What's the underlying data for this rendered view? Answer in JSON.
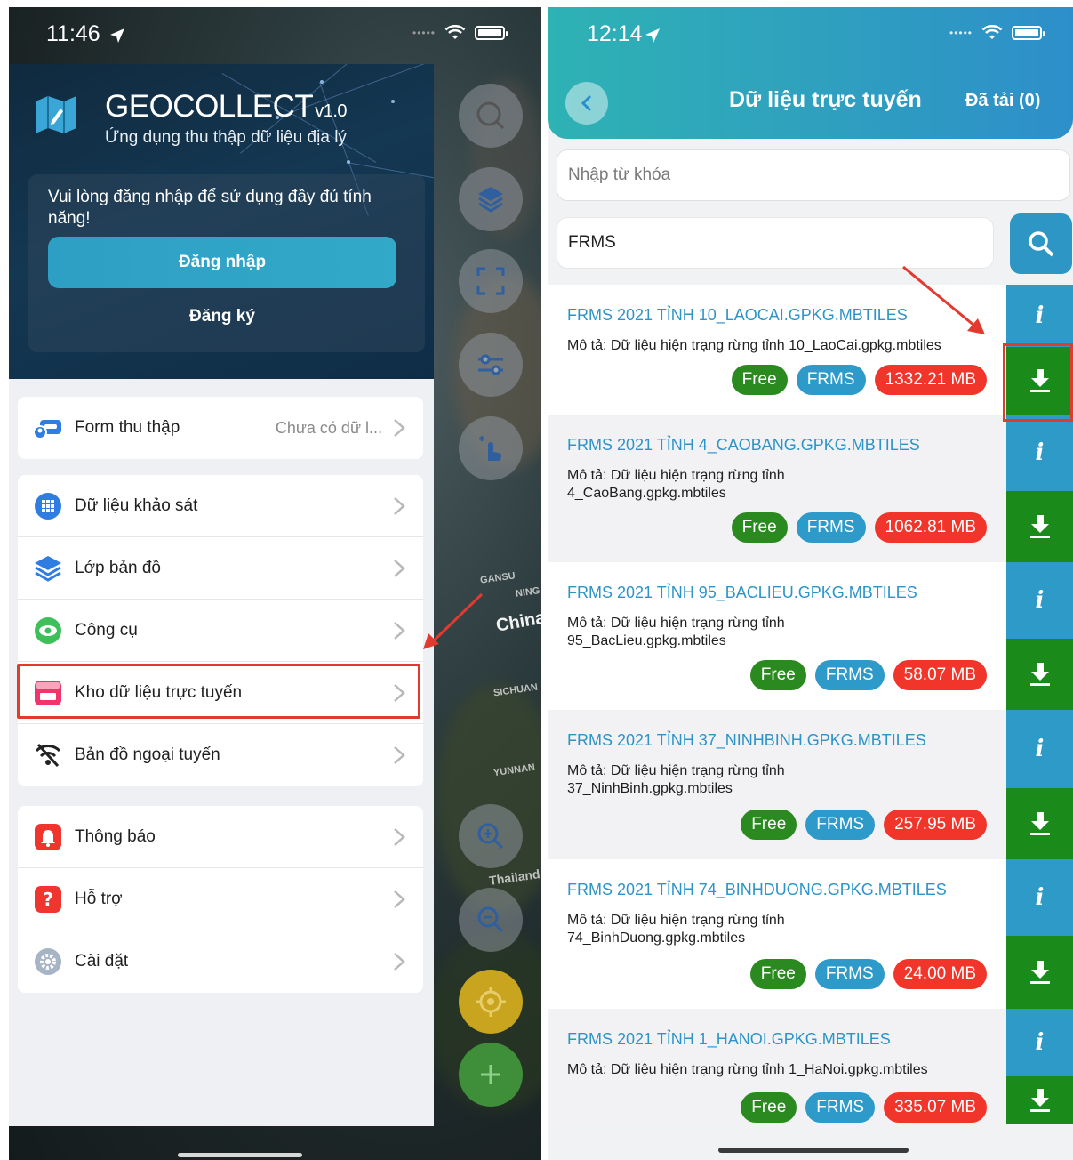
{
  "left_screen": {
    "status_time": "11:46",
    "app": {
      "name": "GEOCOLLECT",
      "version": "v1.0",
      "subtitle": "Ứng dụng thu thập dữ liệu địa lý"
    },
    "login": {
      "message": "Vui lòng đăng nhập để sử dụng đầy đủ tính năng!",
      "login_label": "Đăng nhập",
      "register_label": "Đăng ký"
    },
    "menu": {
      "form": {
        "label": "Form thu thập",
        "value": "Chưa có dữ l..."
      },
      "survey": {
        "label": "Dữ liệu khảo sát"
      },
      "layers": {
        "label": "Lớp bản đồ"
      },
      "tools": {
        "label": "Công cụ"
      },
      "store": {
        "label": "Kho dữ liệu trực tuyến"
      },
      "offline": {
        "label": "Bản đồ ngoại tuyến"
      },
      "notifications": {
        "label": "Thông báo"
      },
      "support": {
        "label": "Hỗ trợ"
      },
      "settings": {
        "label": "Cài đặt"
      }
    },
    "map_labels": [
      "China",
      "Thailand",
      "YUNNAN",
      "SICHUAN",
      "GANSU",
      "NING"
    ]
  },
  "right_screen": {
    "status_time": "12:14",
    "header": {
      "title": "Dữ liệu trực tuyến",
      "downloaded_label": "Đã tải (0)"
    },
    "keyword": {
      "placeholder": "Nhập từ khóa"
    },
    "query": {
      "value": "FRMS"
    },
    "items": [
      {
        "title": "FRMS 2021 TỈNH 10_LAOCAI.GPKG.MBTILES",
        "desc": "Mô tả: Dữ liệu hiện trạng rừng tỉnh 10_LaoCai.gpkg.mbtiles",
        "free": "Free",
        "tag": "FRMS",
        "size": "1332.21 MB"
      },
      {
        "title": "FRMS 2021 TỈNH 4_CAOBANG.GPKG.MBTILES",
        "desc": "Mô tả: Dữ liệu hiện trạng rừng tỉnh 4_CaoBang.gpkg.mbtiles",
        "free": "Free",
        "tag": "FRMS",
        "size": "1062.81 MB"
      },
      {
        "title": "FRMS 2021 TỈNH 95_BACLIEU.GPKG.MBTILES",
        "desc": "Mô tả: Dữ liệu hiện trạng rừng tỉnh 95_BacLieu.gpkg.mbtiles",
        "free": "Free",
        "tag": "FRMS",
        "size": "58.07 MB"
      },
      {
        "title": "FRMS 2021 TỈNH 37_NINHBINH.GPKG.MBTILES",
        "desc": "Mô tả: Dữ liệu hiện trạng rừng tỉnh 37_NinhBinh.gpkg.mbtiles",
        "free": "Free",
        "tag": "FRMS",
        "size": "257.95 MB"
      },
      {
        "title": "FRMS 2021 TỈNH 74_BINHDUONG.GPKG.MBTILES",
        "desc": "Mô tả: Dữ liệu hiện trạng rừng tỉnh 74_BinhDuong.gpkg.mbtiles",
        "free": "Free",
        "tag": "FRMS",
        "size": "24.00 MB"
      },
      {
        "title": "FRMS 2021 TỈNH 1_HANOI.GPKG.MBTILES",
        "desc": "Mô tả: Dữ liệu hiện trạng rừng tỉnh 1_HaNoi.gpkg.mbtiles",
        "free": "Free",
        "tag": "FRMS",
        "size": "335.07 MB"
      }
    ],
    "info_glyph": "i"
  },
  "colors": {
    "primary": "#2e96c4",
    "free": "#2b8a1f",
    "size": "#f2352a",
    "download": "#1a8a1a",
    "highlight": "#e23a2e"
  },
  "icons": [
    "search-icon",
    "layers-icon",
    "fullscreen-icon",
    "sliders-icon",
    "touch-icon",
    "zoom-in-icon",
    "zoom-out-icon",
    "location-icon",
    "plus-icon",
    "back-icon",
    "download-icon",
    "info-icon"
  ]
}
